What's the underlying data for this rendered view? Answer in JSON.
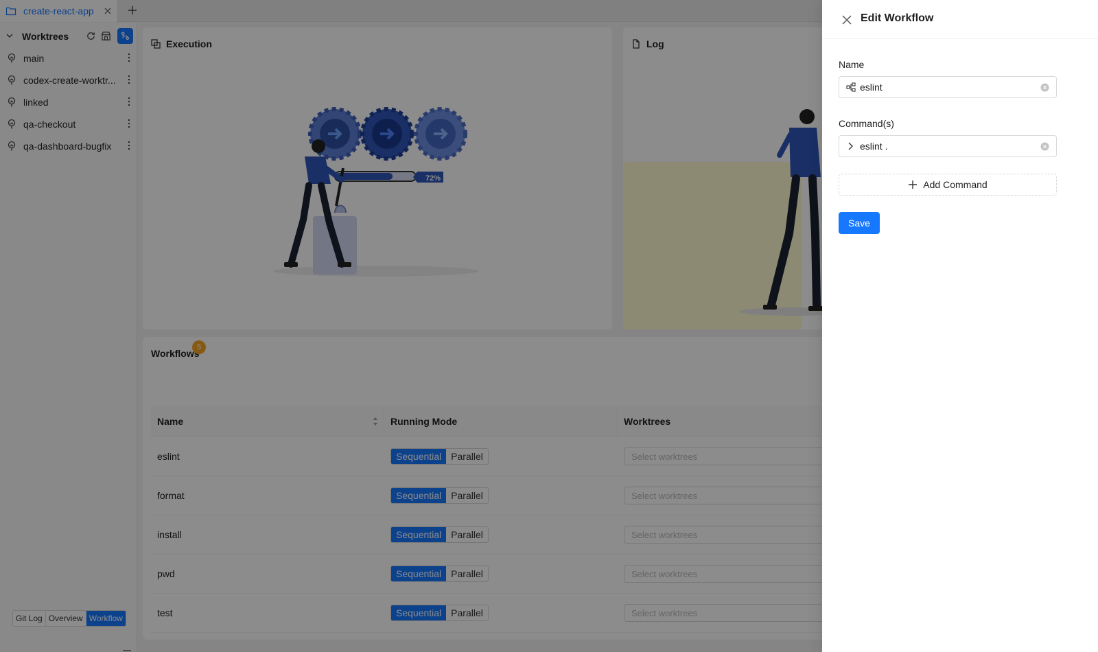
{
  "tabbar": {
    "tab_label": "create-react-app"
  },
  "sidebar": {
    "header_title": "Worktrees",
    "items": [
      {
        "label": "main"
      },
      {
        "label": "codex-create-worktr..."
      },
      {
        "label": "linked"
      },
      {
        "label": "qa-checkout"
      },
      {
        "label": "qa-dashboard-bugfix"
      }
    ],
    "nav": {
      "git_log": "Git Log",
      "overview": "Overview",
      "workflow": "Workflow",
      "active": "Workflow"
    }
  },
  "execution": {
    "title": "Execution",
    "progress_label": "72%",
    "progress": 0.72
  },
  "log": {
    "title": "Log"
  },
  "workflows": {
    "title": "Workflows",
    "badge": "5",
    "columns": {
      "name": "Name",
      "mode": "Running Mode",
      "worktrees": "Worktrees"
    },
    "mode_options": {
      "sequential": "Sequential",
      "parallel": "Parallel"
    },
    "worktrees_placeholder": "Select worktrees",
    "rows": [
      {
        "name": "eslint",
        "mode": "Sequential"
      },
      {
        "name": "format",
        "mode": "Sequential"
      },
      {
        "name": "install",
        "mode": "Sequential"
      },
      {
        "name": "pwd",
        "mode": "Sequential"
      },
      {
        "name": "test",
        "mode": "Sequential"
      }
    ]
  },
  "drawer": {
    "title": "Edit Workflow",
    "name_label": "Name",
    "name_value": "eslint",
    "commands_label": "Command(s)",
    "command_value": "eslint .",
    "add_command": "Add Command",
    "save": "Save"
  },
  "colors": {
    "accent": "#1677ff",
    "badge": "#f5a524",
    "mask": "rgba(0,0,0,0.45)"
  }
}
